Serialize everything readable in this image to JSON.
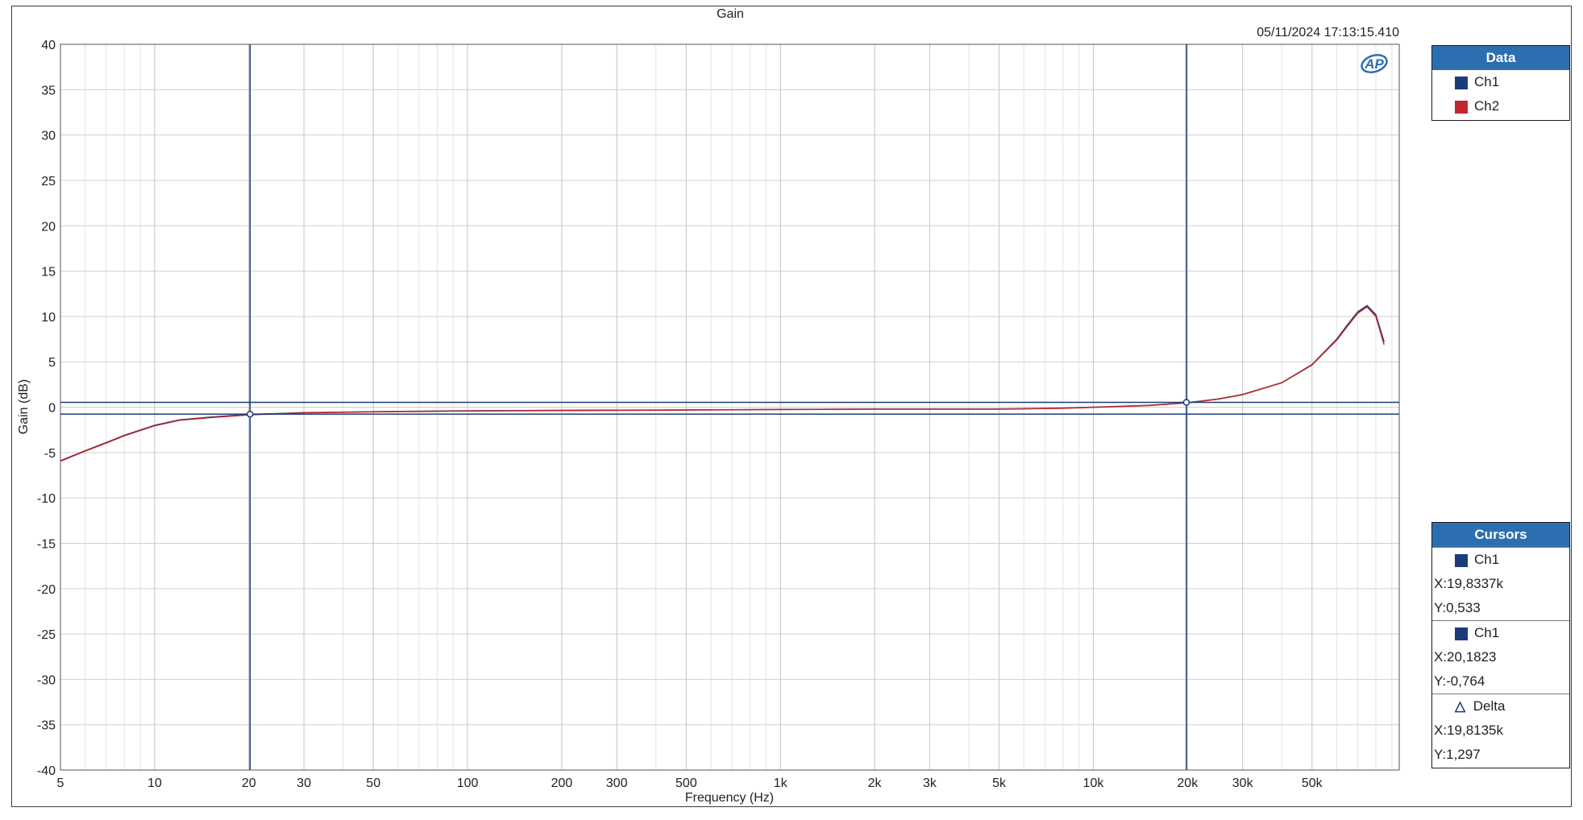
{
  "chart_data": {
    "type": "line",
    "title": "Gain",
    "timestamp": "05/11/2024 17:13:15.410",
    "xlabel": "Frequency (Hz)",
    "ylabel": "Gain (dB)",
    "xscale": "log",
    "xlim": [
      5,
      95000
    ],
    "ylim": [
      -40,
      40
    ],
    "grid": true,
    "x_ticks": [
      {
        "value": 5,
        "label": "5"
      },
      {
        "value": 10,
        "label": "10"
      },
      {
        "value": 20,
        "label": "20"
      },
      {
        "value": 30,
        "label": "30"
      },
      {
        "value": 50,
        "label": "50"
      },
      {
        "value": 100,
        "label": "100"
      },
      {
        "value": 200,
        "label": "200"
      },
      {
        "value": 300,
        "label": "300"
      },
      {
        "value": 500,
        "label": "500"
      },
      {
        "value": 1000,
        "label": "1k"
      },
      {
        "value": 2000,
        "label": "2k"
      },
      {
        "value": 3000,
        "label": "3k"
      },
      {
        "value": 5000,
        "label": "5k"
      },
      {
        "value": 10000,
        "label": "10k"
      },
      {
        "value": 20000,
        "label": "20k"
      },
      {
        "value": 30000,
        "label": "30k"
      },
      {
        "value": 50000,
        "label": "50k"
      }
    ],
    "y_ticks": [
      {
        "value": 40,
        "label": "40"
      },
      {
        "value": 35,
        "label": "35"
      },
      {
        "value": 30,
        "label": "30"
      },
      {
        "value": 25,
        "label": "25"
      },
      {
        "value": 20,
        "label": "20"
      },
      {
        "value": 15,
        "label": "15"
      },
      {
        "value": 10,
        "label": "10"
      },
      {
        "value": 5,
        "label": "5"
      },
      {
        "value": 0,
        "label": "0"
      },
      {
        "value": -5,
        "label": "-5"
      },
      {
        "value": -10,
        "label": "-10"
      },
      {
        "value": -15,
        "label": "-15"
      },
      {
        "value": -20,
        "label": "-20"
      },
      {
        "value": -25,
        "label": "-25"
      },
      {
        "value": -30,
        "label": "-30"
      },
      {
        "value": -35,
        "label": "-35"
      },
      {
        "value": -40,
        "label": "-40"
      }
    ],
    "series": [
      {
        "name": "Ch1",
        "color": "#1b3c78",
        "x": [
          5,
          6,
          7,
          8,
          10,
          12,
          15,
          20,
          25,
          30,
          50,
          100,
          200,
          500,
          1000,
          2000,
          5000,
          8000,
          10000,
          15000,
          20000,
          25000,
          30000,
          40000,
          50000,
          60000,
          65000,
          70000,
          75000,
          80000,
          85000
        ],
        "y": [
          -5.9,
          -4.8,
          -3.9,
          -3.1,
          -2.0,
          -1.4,
          -1.1,
          -0.8,
          -0.7,
          -0.6,
          -0.5,
          -0.4,
          -0.35,
          -0.3,
          -0.25,
          -0.2,
          -0.2,
          -0.1,
          0.0,
          0.2,
          0.5,
          0.9,
          1.4,
          2.7,
          4.7,
          7.5,
          9.1,
          10.5,
          11.2,
          10.2,
          7.2
        ]
      },
      {
        "name": "Ch2",
        "color": "#c0282d",
        "x": [
          5,
          6,
          7,
          8,
          10,
          12,
          15,
          20,
          25,
          30,
          50,
          100,
          200,
          500,
          1000,
          2000,
          5000,
          8000,
          10000,
          15000,
          20000,
          25000,
          30000,
          40000,
          50000,
          60000,
          65000,
          70000,
          75000,
          80000,
          85000
        ],
        "y": [
          -5.95,
          -4.85,
          -3.95,
          -3.15,
          -2.05,
          -1.45,
          -1.15,
          -0.85,
          -0.72,
          -0.62,
          -0.52,
          -0.42,
          -0.37,
          -0.32,
          -0.27,
          -0.22,
          -0.22,
          -0.12,
          -0.02,
          0.18,
          0.48,
          0.88,
          1.38,
          2.68,
          4.65,
          7.4,
          8.95,
          10.35,
          11.05,
          10.0,
          6.9
        ]
      }
    ],
    "cursors": {
      "vertical": [
        20.1823,
        19833.7
      ],
      "horizontal": [
        0.533,
        -0.764
      ],
      "points": [
        {
          "x": 20.1823,
          "y": -0.764
        },
        {
          "x": 19833.7,
          "y": 0.533
        }
      ]
    },
    "logo_text": "AP"
  },
  "data_panel": {
    "title": "Data",
    "items": [
      {
        "label": "Ch1",
        "color": "#1b3c78"
      },
      {
        "label": "Ch2",
        "color": "#c0282d"
      }
    ]
  },
  "cursors_panel": {
    "title": "Cursors",
    "c1": {
      "label": "Ch1",
      "color": "#1b3c78",
      "x": "X:19,8337k",
      "y": "Y:0,533"
    },
    "c2": {
      "label": "Ch1",
      "color": "#1b3c78",
      "x": "X:20,1823",
      "y": "Y:-0,764"
    },
    "delta": {
      "label": "Delta",
      "x": "X:19,8135k",
      "y": "Y:1,297"
    }
  }
}
